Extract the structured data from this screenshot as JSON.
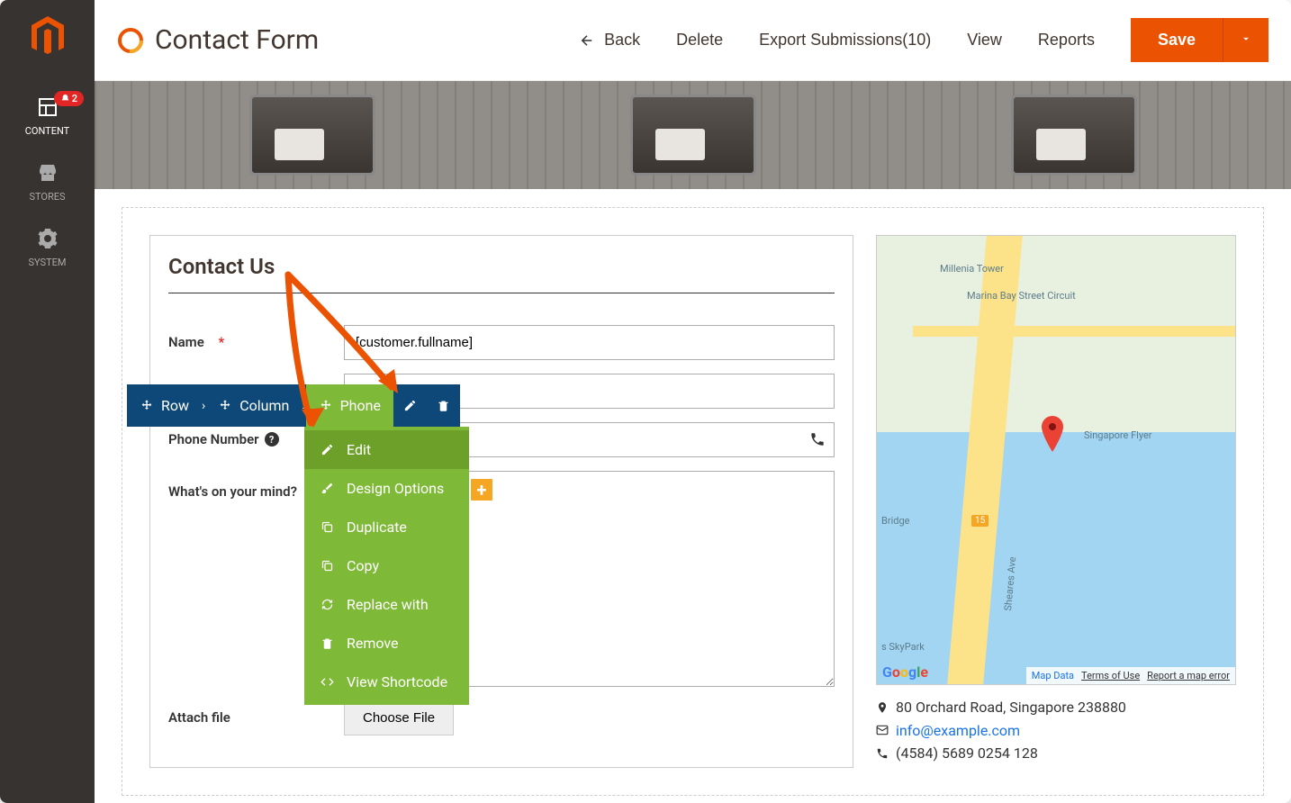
{
  "sidebar": {
    "items": [
      {
        "label": "CONTENT",
        "badge": "2"
      },
      {
        "label": "STORES"
      },
      {
        "label": "SYSTEM"
      }
    ]
  },
  "header": {
    "title": "Contact Form",
    "back": "Back",
    "delete": "Delete",
    "export": "Export Submissions(10)",
    "view": "View",
    "reports": "Reports",
    "save": "Save"
  },
  "form": {
    "title": "Contact Us",
    "name_label": "Name",
    "name_value": "[customer.fullname]",
    "phone_label": "Phone Number",
    "mind_label": "What's on your mind?",
    "attach_label": "Attach file",
    "choose_file": "Choose File"
  },
  "breadcrumb": {
    "row": "Row",
    "column": "Column",
    "phone": "Phone"
  },
  "context_menu": {
    "edit": "Edit",
    "design": "Design Options",
    "duplicate": "Duplicate",
    "copy": "Copy",
    "replace": "Replace with",
    "remove": "Remove",
    "shortcode": "View Shortcode"
  },
  "map": {
    "millenia": "Millenia Tower",
    "marina": "Marina Bay Street Circuit",
    "flyer": "Singapore Flyer",
    "bridge": "Bridge",
    "skypark": "s SkyPark",
    "sheares": "Sheares Ave",
    "badge15": "15",
    "glogo": "Google",
    "attr_mapdata": "Map Data",
    "attr_terms": "Terms of Use",
    "attr_report": "Report a map error"
  },
  "contact": {
    "address": "80 Orchard Road, Singapore 238880",
    "email": "info@example.com",
    "phone": "(4584) 5689 0254 128"
  }
}
